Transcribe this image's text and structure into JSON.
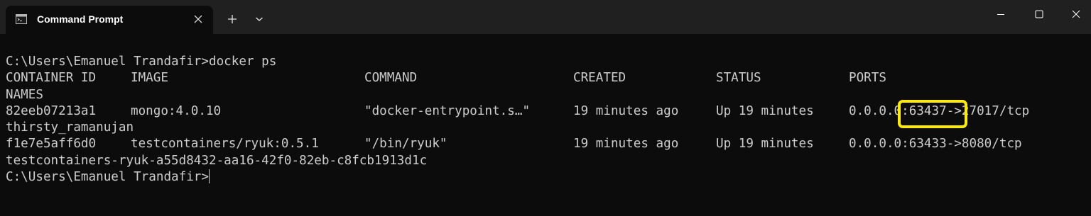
{
  "window": {
    "tab_title": "Command Prompt",
    "icons": {
      "tab": "command-prompt-icon",
      "close_tab": "close-icon",
      "new_tab": "plus-icon",
      "dropdown": "chevron-down-icon",
      "minimize": "minimize-icon",
      "maximize": "maximize-icon",
      "close_window": "close-icon"
    }
  },
  "terminal": {
    "command_line": "C:\\Users\\Emanuel Trandafir>docker ps",
    "headers": {
      "container_id": "CONTAINER ID",
      "image": "IMAGE",
      "command": "COMMAND",
      "created": "CREATED",
      "status": "STATUS",
      "ports": "PORTS",
      "names": "NAMES"
    },
    "containers": [
      {
        "container_id": "82eeb07213a1",
        "image": "mongo:4.0.10",
        "command": "\"docker-entrypoint.s…\"",
        "created": "19 minutes ago",
        "status": "Up 19 minutes",
        "ports": "0.0.0.0:63437->27017/tcp",
        "name": "thirsty_ramanujan"
      },
      {
        "container_id": "f1e7e5aff6d0",
        "image": "testcontainers/ryuk:0.5.1",
        "command": "\"/bin/ryuk\"",
        "created": "19 minutes ago",
        "status": "Up 19 minutes",
        "ports": "0.0.0.0:63433->8080/tcp",
        "name": "testcontainers-ryuk-a55d8432-aa16-42f0-82eb-c8fcb1913d1c"
      }
    ],
    "prompt": "C:\\Users\\Emanuel Trandafir>"
  },
  "colors": {
    "background": "#0c0c0c",
    "titlebar": "#202020",
    "text": "#cccccc",
    "highlight": "#ffeb00"
  }
}
